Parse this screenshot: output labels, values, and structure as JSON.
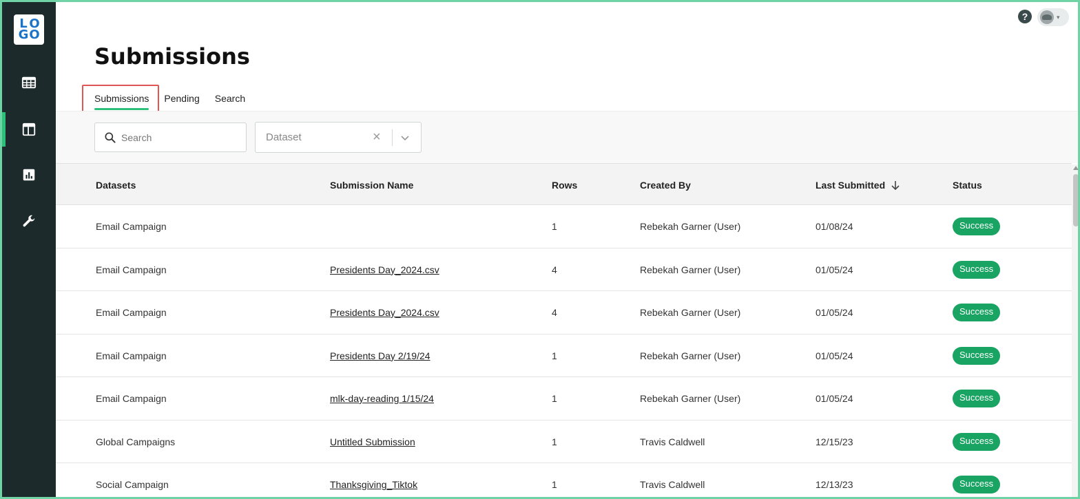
{
  "logo": {
    "letters": [
      "L",
      "O",
      "G",
      "O"
    ]
  },
  "sidebar": {
    "items": [
      {
        "icon": "table-grid-icon"
      },
      {
        "icon": "layout-icon",
        "active": true
      },
      {
        "icon": "bar-chart-icon"
      },
      {
        "icon": "wrench-icon"
      }
    ]
  },
  "header": {
    "help": "?",
    "avatar_chevron": "▾"
  },
  "page": {
    "title": "Submissions"
  },
  "tabs": [
    {
      "label": "Submissions",
      "active": true
    },
    {
      "label": "Pending"
    },
    {
      "label": "Search"
    }
  ],
  "filters": {
    "search_placeholder": "Search",
    "dataset_placeholder": "Dataset",
    "clear": "×"
  },
  "table": {
    "columns": [
      "Datasets",
      "Submission Name",
      "Rows",
      "Created By",
      "Last Submitted",
      "Status"
    ],
    "rows": [
      {
        "dataset": "Email Campaign",
        "name": "",
        "rows": "1",
        "created_by": "Rebekah Garner (User)",
        "last": "01/08/24",
        "status": "Success"
      },
      {
        "dataset": "Email Campaign",
        "name": "Presidents Day_2024.csv",
        "rows": "4",
        "created_by": "Rebekah Garner (User)",
        "last": "01/05/24",
        "status": "Success"
      },
      {
        "dataset": "Email Campaign",
        "name": "Presidents Day_2024.csv",
        "rows": "4",
        "created_by": "Rebekah Garner (User)",
        "last": "01/05/24",
        "status": "Success"
      },
      {
        "dataset": "Email Campaign",
        "name": "Presidents Day 2/19/24",
        "rows": "1",
        "created_by": "Rebekah Garner (User)",
        "last": "01/05/24",
        "status": "Success"
      },
      {
        "dataset": "Email Campaign",
        "name": "mlk-day-reading 1/15/24",
        "rows": "1",
        "created_by": "Rebekah Garner (User)",
        "last": "01/05/24",
        "status": "Success"
      },
      {
        "dataset": "Global Campaigns",
        "name": "Untitled Submission",
        "rows": "1",
        "created_by": "Travis Caldwell",
        "last": "12/15/23",
        "status": "Success"
      },
      {
        "dataset": "Social Campaign",
        "name": "Thanksgiving_Tiktok",
        "rows": "1",
        "created_by": "Travis Caldwell",
        "last": "12/13/23",
        "status": "Success"
      }
    ]
  },
  "colors": {
    "accent": "#2cc07a",
    "sidebar": "#1c2a2c",
    "success": "#19a463",
    "logo": "#1a73c9",
    "highlight": "#e05555"
  }
}
